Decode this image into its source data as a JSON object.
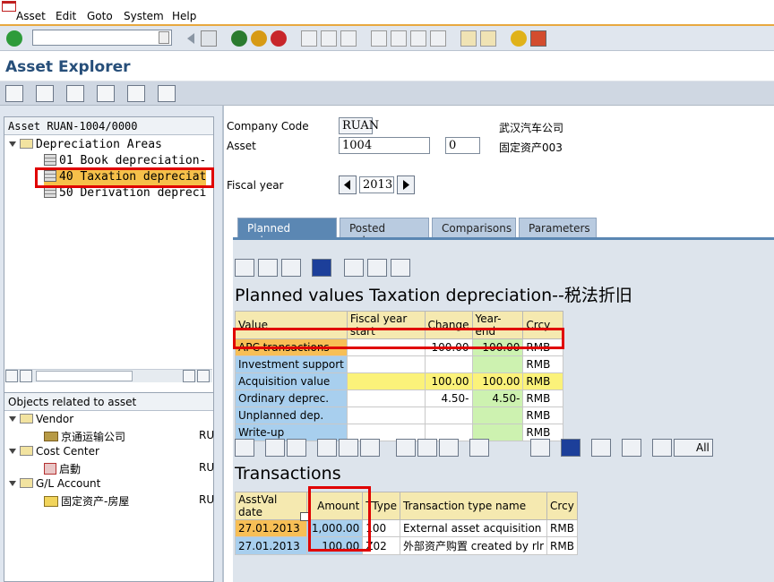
{
  "menu": {
    "items": [
      "Asset",
      "Edit",
      "Goto",
      "System",
      "Help"
    ]
  },
  "title": "Asset Explorer",
  "tree": {
    "header": "Asset RUAN-1004/0000",
    "root": "Depreciation Areas",
    "areas": [
      "01 Book depreciation-",
      "40 Taxation depreciat",
      "50 Derivation depreci"
    ]
  },
  "related": {
    "header": "Objects related to asset",
    "groups": [
      {
        "label": "Vendor",
        "child": "京通运输公司",
        "code": "RU"
      },
      {
        "label": "Cost Center",
        "child": "启動",
        "code": "RU"
      },
      {
        "label": "G/L Account",
        "child": "固定资产-房屋",
        "code": "RU"
      }
    ]
  },
  "header": {
    "company_code_label": "Company Code",
    "company_code": "RUAN",
    "company_name": "武汉汽车公司",
    "asset_label": "Asset",
    "asset_number": "1004",
    "asset_sub": "0",
    "asset_desc": "固定资产003",
    "fiscal_year_label": "Fiscal year",
    "fiscal_year": "2013"
  },
  "tabs": [
    "Planned values",
    "Posted values",
    "Comparisons",
    "Parameters"
  ],
  "planned": {
    "title": "Planned values Taxation depreciation--税法折旧",
    "columns": [
      "Value",
      "Fiscal year start",
      "Change",
      "Year-end",
      "Crcy"
    ],
    "rows": [
      {
        "label": "APC transactions",
        "start": "",
        "change": "100.00",
        "end": "100.00",
        "crcy": "RMB"
      },
      {
        "label": "Investment support",
        "start": "",
        "change": "",
        "end": "",
        "crcy": "RMB"
      },
      {
        "label": "Acquisition value",
        "start": "",
        "change": "100.00",
        "end": "100.00",
        "crcy": "RMB"
      },
      {
        "label": "Ordinary deprec.",
        "start": "",
        "change": "4.50-",
        "end": "4.50-",
        "crcy": "RMB"
      },
      {
        "label": "Unplanned dep.",
        "start": "",
        "change": "",
        "end": "",
        "crcy": "RMB"
      },
      {
        "label": "Write-up",
        "start": "",
        "change": "",
        "end": "",
        "crcy": "RMB"
      }
    ]
  },
  "transactions": {
    "title": "Transactions",
    "all_label": "All",
    "columns": [
      "AsstVal date",
      "Amount",
      "TType",
      "Transaction type name",
      "Crcy"
    ],
    "rows": [
      {
        "date": "27.01.2013",
        "amount": "1,000.00",
        "ttype": "100",
        "name": "External asset acquisition",
        "crcy": "RMB"
      },
      {
        "date": "27.01.2013",
        "amount": "100.00",
        "ttype": "Z02",
        "name": "外部资产购置 created by rlr",
        "crcy": "RMB"
      }
    ]
  }
}
